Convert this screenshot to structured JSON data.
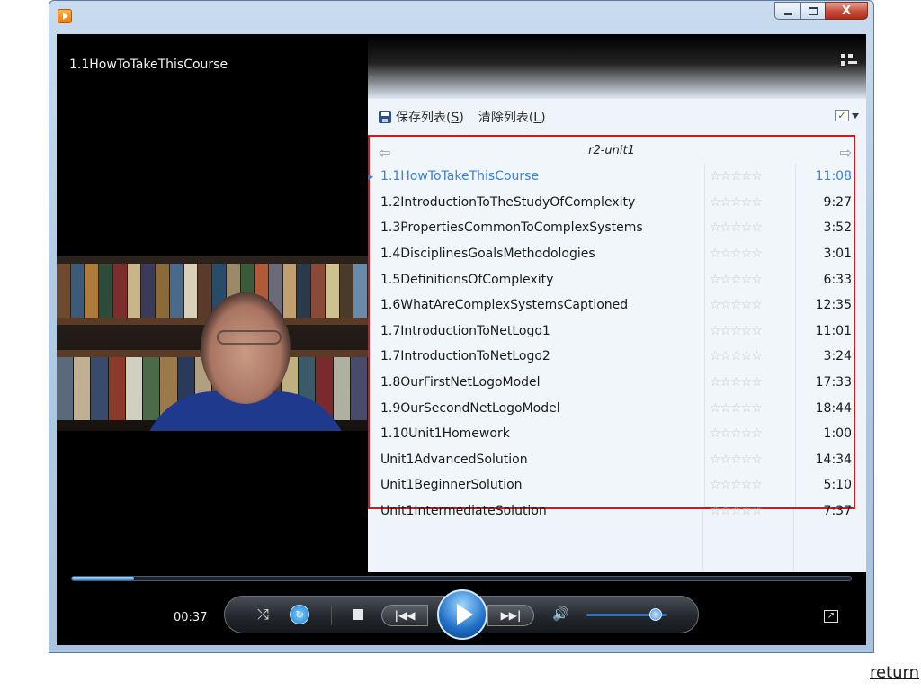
{
  "window": {
    "icon": "media-player-icon",
    "controls": {
      "minimize": "minimize-icon",
      "maximize": "maximize-icon",
      "close_label": "X"
    }
  },
  "now_playing": {
    "title": "1.1HowToTakeThisCourse"
  },
  "toolbar": {
    "save_text": "保存列表(",
    "save_key": "S",
    "clear_text": "清除列表(",
    "clear_key": "L",
    "close_paren": ")"
  },
  "playlist": {
    "name": "r2-unit1",
    "items": [
      {
        "title": "1.1HowToTakeThisCourse",
        "duration": "11:08",
        "current": true
      },
      {
        "title": "1.2IntroductionToTheStudyOfComplexity",
        "duration": "9:27"
      },
      {
        "title": "1.3PropertiesCommonToComplexSystems",
        "duration": "3:52"
      },
      {
        "title": "1.4DisciplinesGoalsMethodologies",
        "duration": "3:01"
      },
      {
        "title": "1.5DefinitionsOfComplexity",
        "duration": "6:33"
      },
      {
        "title": "1.6WhatAreComplexSystemsCaptioned",
        "duration": "12:35"
      },
      {
        "title": "1.7IntroductionToNetLogo1",
        "duration": "11:01"
      },
      {
        "title": "1.7IntroductionToNetLogo2",
        "duration": "3:24"
      },
      {
        "title": "1.8OurFirstNetLogoModel",
        "duration": "17:33"
      },
      {
        "title": "1.9OurSecondNetLogoModel",
        "duration": "18:44"
      },
      {
        "title": "1.10Unit1Homework",
        "duration": "1:00"
      },
      {
        "title": "Unit1AdvancedSolution",
        "duration": "14:34"
      },
      {
        "title": "Unit1BeginnerSolution",
        "duration": "5:10"
      },
      {
        "title": "Unit1IntermediateSolution",
        "duration": "7:37"
      }
    ],
    "rating_stars": "☆☆☆☆☆"
  },
  "controls": {
    "elapsed": "00:37",
    "seek_fraction": 0.08,
    "volume_fraction": 0.85
  },
  "footer": {
    "return_link": "return"
  }
}
